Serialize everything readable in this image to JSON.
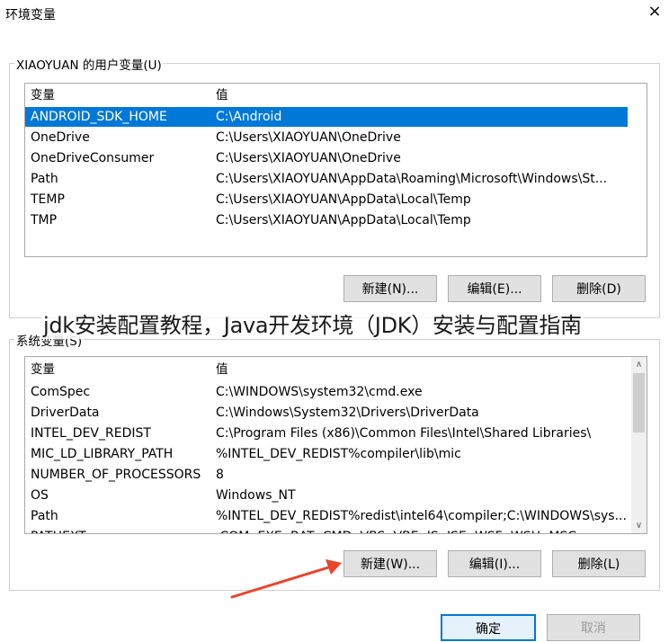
{
  "window": {
    "title": "环境变量",
    "close_icon": "×"
  },
  "user_vars": {
    "group_label": "XIAOYUAN 的用户变量(U)",
    "headers": [
      "变量",
      "值"
    ],
    "rows": [
      {
        "name": "ANDROID_SDK_HOME",
        "value": "C:\\Android",
        "selected": true
      },
      {
        "name": "OneDrive",
        "value": "C:\\Users\\XIAOYUAN\\OneDrive"
      },
      {
        "name": "OneDriveConsumer",
        "value": "C:\\Users\\XIAOYUAN\\OneDrive"
      },
      {
        "name": "Path",
        "value": "C:\\Users\\XIAOYUAN\\AppData\\Roaming\\Microsoft\\Windows\\St..."
      },
      {
        "name": "TEMP",
        "value": "C:\\Users\\XIAOYUAN\\AppData\\Local\\Temp"
      },
      {
        "name": "TMP",
        "value": "C:\\Users\\XIAOYUAN\\AppData\\Local\\Temp"
      }
    ],
    "buttons": {
      "new": "新建(N)...",
      "edit": "编辑(E)...",
      "delete": "删除(D)"
    }
  },
  "system_vars": {
    "group_label": "系统变量(S)",
    "headers": [
      "变量",
      "值"
    ],
    "rows": [
      {
        "name": "ComSpec",
        "value": "C:\\WINDOWS\\system32\\cmd.exe"
      },
      {
        "name": "DriverData",
        "value": "C:\\Windows\\System32\\Drivers\\DriverData"
      },
      {
        "name": "INTEL_DEV_REDIST",
        "value": "C:\\Program Files (x86)\\Common Files\\Intel\\Shared Libraries\\"
      },
      {
        "name": "MIC_LD_LIBRARY_PATH",
        "value": "%INTEL_DEV_REDIST%compiler\\lib\\mic"
      },
      {
        "name": "NUMBER_OF_PROCESSORS",
        "value": "8"
      },
      {
        "name": "OS",
        "value": "Windows_NT"
      },
      {
        "name": "Path",
        "value": "%INTEL_DEV_REDIST%redist\\intel64\\compiler;C:\\WINDOWS\\sys..."
      },
      {
        "name": "PATHEXT",
        "value": ".COM;.EXE;.BAT;.CMD;.VBS;.VBE;.JS;.JSE;.WSF;.WSH;.MSC"
      }
    ],
    "scroll_up_icon": "∧",
    "scroll_down_icon": "∨",
    "buttons": {
      "new": "新建(W)...",
      "edit": "编辑(I)...",
      "delete": "删除(L)"
    }
  },
  "footer": {
    "ok": "确定",
    "cancel": "取消"
  },
  "overlay_caption": "jdk安装配置教程，Java开发环境（JDK）安装与配置指南",
  "colors": {
    "selection": "#0078d7",
    "arrow": "#e8452c"
  }
}
